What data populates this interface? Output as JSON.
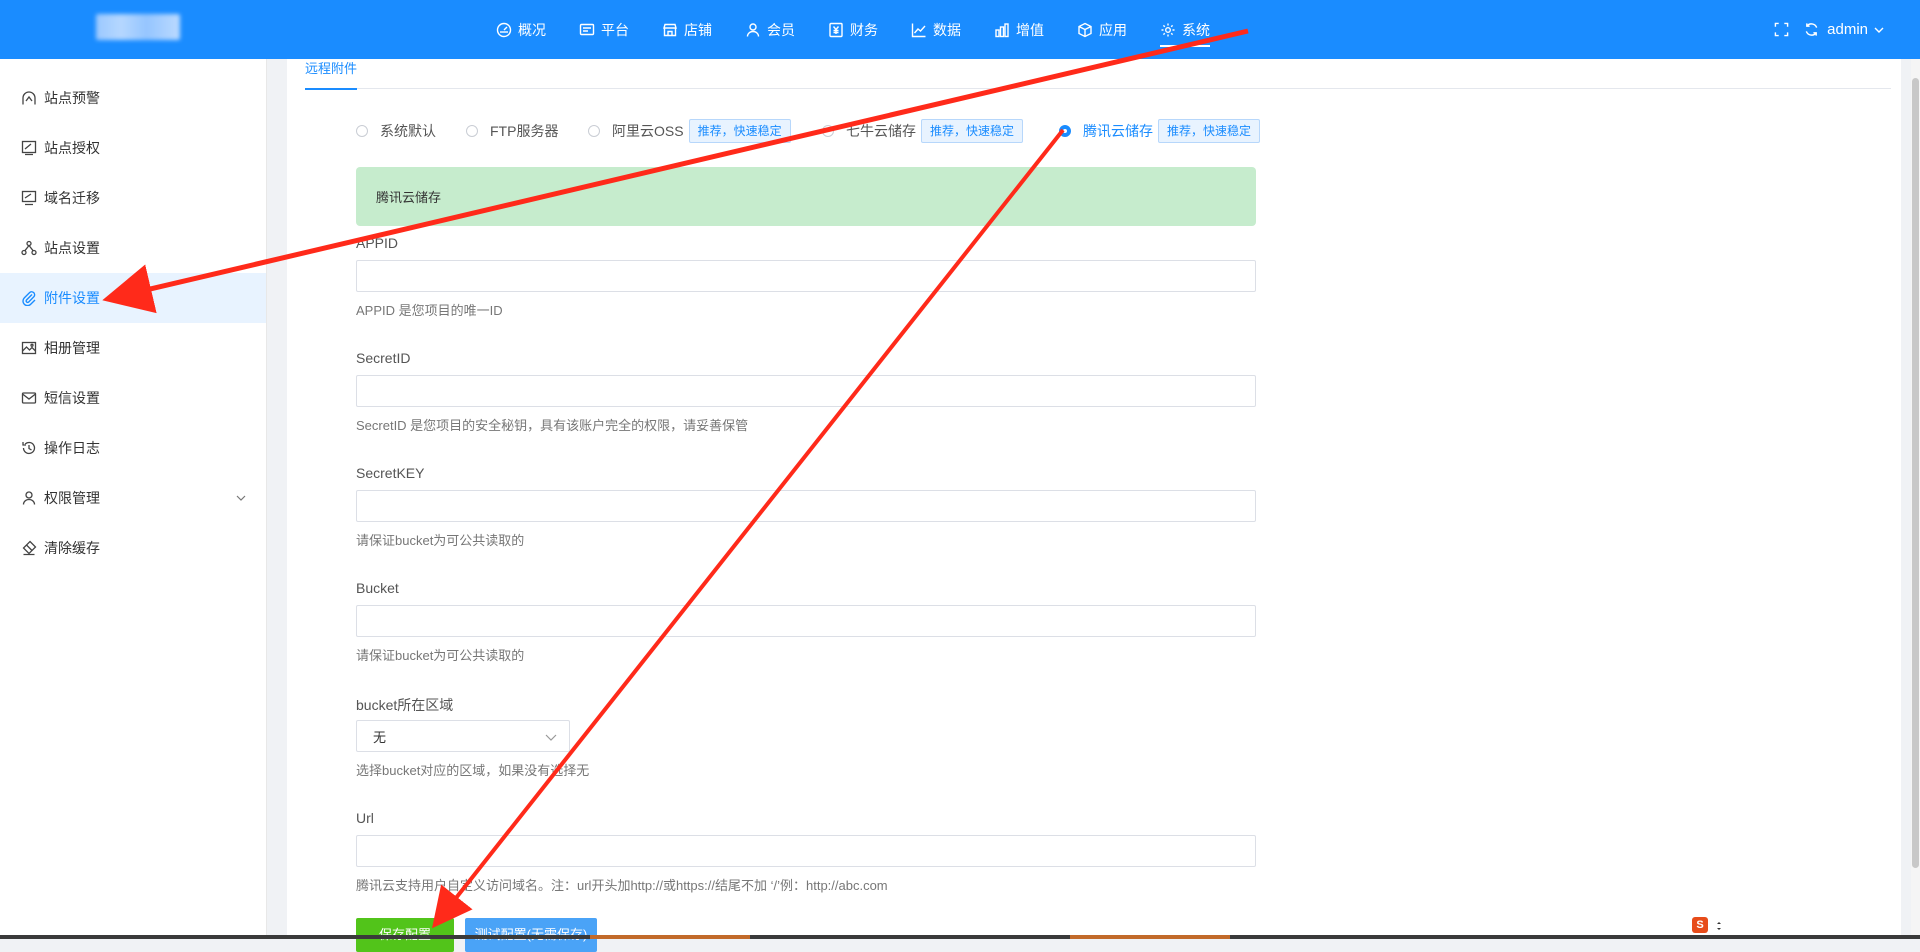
{
  "header": {
    "nav": [
      {
        "label": "概况",
        "icon": "dashboard-icon"
      },
      {
        "label": "平台",
        "icon": "platform-icon"
      },
      {
        "label": "店铺",
        "icon": "shop-icon"
      },
      {
        "label": "会员",
        "icon": "member-icon"
      },
      {
        "label": "财务",
        "icon": "finance-icon"
      },
      {
        "label": "数据",
        "icon": "data-icon"
      },
      {
        "label": "增值",
        "icon": "addon-icon"
      },
      {
        "label": "应用",
        "icon": "app-icon"
      },
      {
        "label": "系统",
        "icon": "system-gear-icon",
        "active": true
      }
    ],
    "user": "admin"
  },
  "sidebar": {
    "items": [
      {
        "label": "站点预警",
        "icon": "alert-icon"
      },
      {
        "label": "站点授权",
        "icon": "license-icon"
      },
      {
        "label": "域名迁移",
        "icon": "domain-icon"
      },
      {
        "label": "站点设置",
        "icon": "sitemap-icon"
      },
      {
        "label": "附件设置",
        "icon": "paperclip-icon",
        "active": true
      },
      {
        "label": "相册管理",
        "icon": "image-icon"
      },
      {
        "label": "短信设置",
        "icon": "mail-icon"
      },
      {
        "label": "操作日志",
        "icon": "history-icon"
      },
      {
        "label": "权限管理",
        "icon": "user-icon",
        "expandable": true
      },
      {
        "label": "清除缓存",
        "icon": "eraser-icon"
      }
    ]
  },
  "main": {
    "tab": "远程附件",
    "storage_options": [
      {
        "label": "系统默认",
        "badge": ""
      },
      {
        "label": "FTP服务器",
        "badge": ""
      },
      {
        "label": "阿里云OSS",
        "badge": "推荐，快速稳定"
      },
      {
        "label": "七牛云储存",
        "badge": "推荐，快速稳定"
      },
      {
        "label": "腾讯云储存",
        "badge": "推荐，快速稳定",
        "checked": true
      }
    ],
    "alert_title": "腾讯云储存",
    "fields": {
      "appid": {
        "label": "APPID",
        "value": "",
        "help": "APPID 是您项目的唯一ID"
      },
      "secret_id": {
        "label": "SecretID",
        "value": "",
        "help": "SecretID 是您项目的安全秘钥，具有该账户完全的权限，请妥善保管"
      },
      "secret_key": {
        "label": "SecretKEY",
        "value": "",
        "help": "请保证bucket为可公共读取的"
      },
      "bucket": {
        "label": "Bucket",
        "value": "",
        "help": "请保证bucket为可公共读取的"
      },
      "region": {
        "label": "bucket所在区域",
        "value": "无",
        "help": "选择bucket对应的区域，如果没有选择无"
      },
      "url": {
        "label": "Url",
        "value": "",
        "help": "腾讯云支持用户自定义访问域名。注：url开头加http://或https://结尾不加 ‘/’例：http://abc.com"
      }
    },
    "buttons": {
      "save": "保存配置",
      "test": "测试配置(无需保存)"
    }
  },
  "colors": {
    "primary": "#1a8cff",
    "success_bg": "#c6eccd",
    "save_button": "#52c41a",
    "annotation_arrow": "#ff2a1a"
  }
}
